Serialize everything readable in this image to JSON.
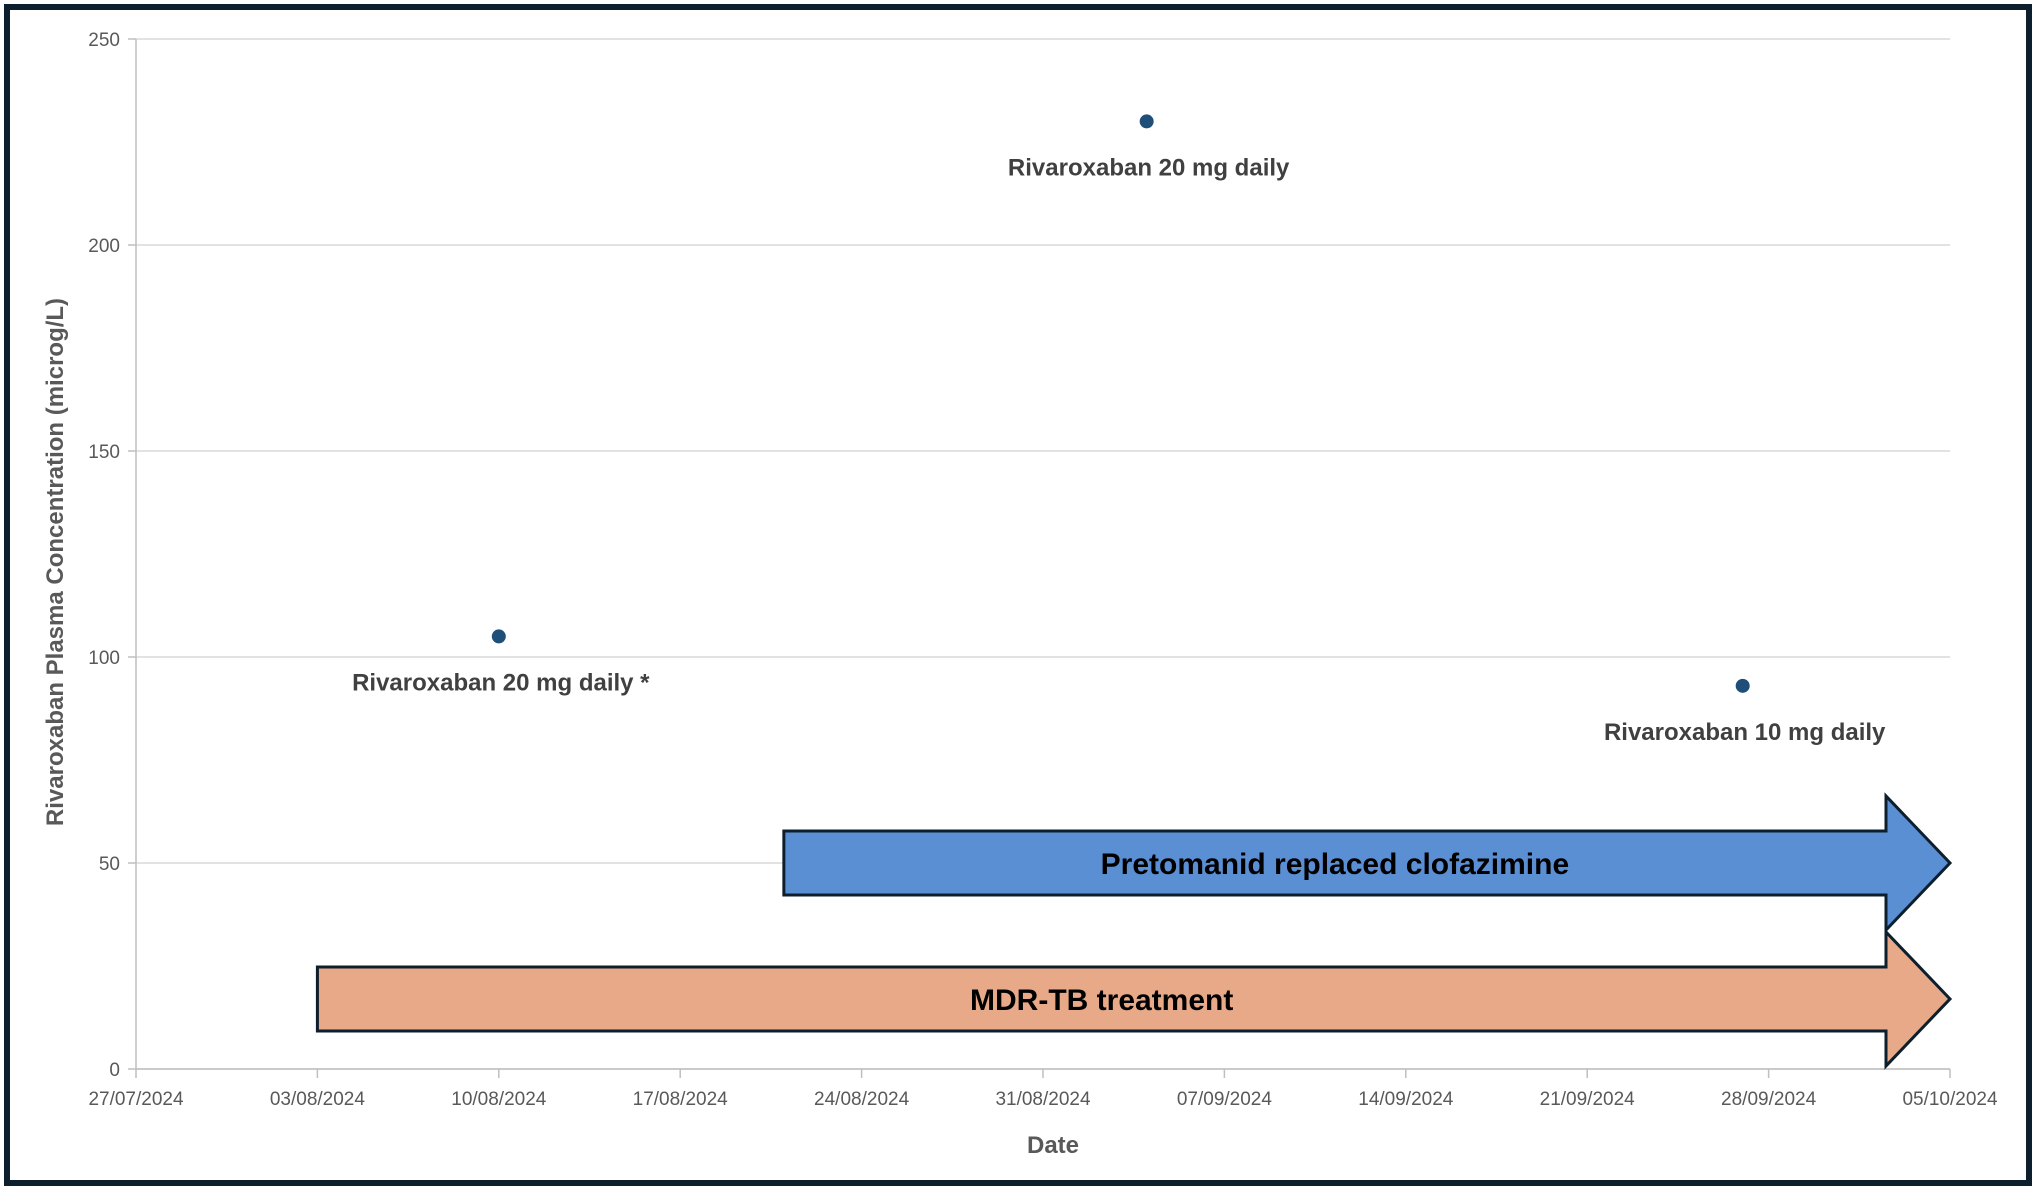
{
  "chart_data": {
    "type": "scatter",
    "title": "",
    "xlabel": "Date",
    "ylabel": "Rivaroxaban Plasma Concentration (microg/L)",
    "x_axis_type": "date",
    "xlim": [
      "27/07/2024",
      "05/10/2024"
    ],
    "ylim": [
      0,
      250
    ],
    "x_ticks": [
      "27/07/2024",
      "03/08/2024",
      "10/08/2024",
      "17/08/2024",
      "24/08/2024",
      "31/08/2024",
      "07/09/2024",
      "14/09/2024",
      "21/09/2024",
      "28/09/2024",
      "05/10/2024"
    ],
    "y_ticks": [
      0,
      50,
      100,
      150,
      200,
      250
    ],
    "grid": "horizontal",
    "marker_color": "#1f4e79",
    "points": [
      {
        "x": "10/08/2024",
        "y": 105,
        "label": "Rivaroxaban 20 mg daily *"
      },
      {
        "x": "04/09/2024",
        "y": 230,
        "label": "Rivaroxaban 20 mg daily"
      },
      {
        "x": "27/09/2024",
        "y": 93,
        "label": "Rivaroxaban 10 mg daily"
      }
    ],
    "annotations": [
      {
        "type": "arrow",
        "text": "Pretomanid replaced clofazimine",
        "x_start": "21/08/2024",
        "x_end": "05/10/2024",
        "y_center": 50,
        "fill": "#5b8fd4"
      },
      {
        "type": "arrow",
        "text": "MDR-TB treatment",
        "x_start": "03/08/2024",
        "x_end": "05/10/2024",
        "y_center": 17,
        "fill": "#e8a988"
      }
    ]
  }
}
